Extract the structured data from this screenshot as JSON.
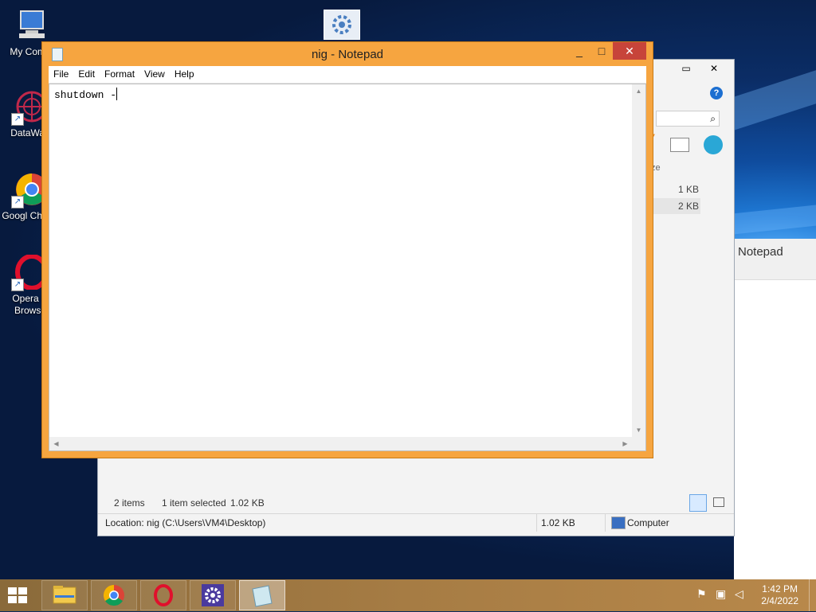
{
  "desktop": {
    "icons": [
      {
        "label": "My Comp"
      },
      {
        "label": "DataWag"
      },
      {
        "label": "Googl Chrom"
      },
      {
        "label": "Opera C Browse"
      }
    ]
  },
  "explorer": {
    "size_header": "ze",
    "file_sizes": [
      "1 KB",
      "2 KB"
    ],
    "items_count": "2 items",
    "selected_info": "1 item selected",
    "selected_size": "1.02 KB",
    "location": "Location: nig (C:\\Users\\VM4\\Desktop)",
    "location_size": "1.02 KB",
    "computer_label": "Computer",
    "window_buttons": {
      "minimize": "▭",
      "close": "✕"
    }
  },
  "preview": {
    "title": "Notepad"
  },
  "notepad": {
    "title": "nig - Notepad",
    "menus": [
      "File",
      "Edit",
      "Format",
      "View",
      "Help"
    ],
    "content": "shutdown -",
    "window_buttons": {
      "minimize": "_",
      "maximize": "□",
      "close": "✕"
    }
  },
  "taskbar": {
    "time": "1:42 PM",
    "date": "2/4/2022",
    "buttons": [
      "File Explorer",
      "Google Chrome",
      "Opera",
      "Settings",
      "Notepad"
    ]
  },
  "colors": {
    "notepad_frame": "#f6a540",
    "taskbar": "#a67c44",
    "desktop_bg": "#0b2d66"
  }
}
